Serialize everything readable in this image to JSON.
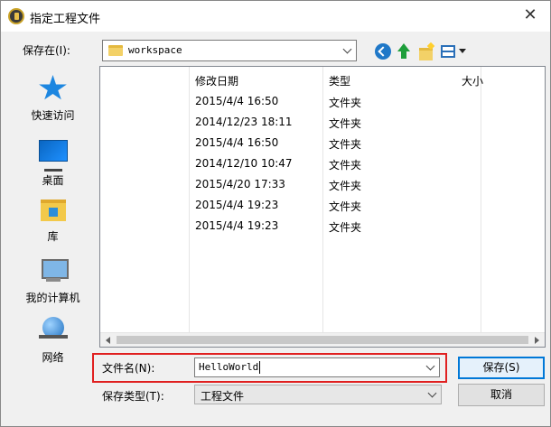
{
  "window": {
    "title": "指定工程文件",
    "close_glyph": "✕"
  },
  "location": {
    "label": "保存在(I):",
    "value": "workspace"
  },
  "toolbar": {
    "back": "back-icon",
    "up": "up-folder-icon",
    "new_folder": "new-folder-icon",
    "view_menu": "view-menu-icon"
  },
  "places": [
    {
      "label": "快速访问",
      "icon": "star-icon"
    },
    {
      "label": "桌面",
      "icon": "desktop-icon"
    },
    {
      "label": "库",
      "icon": "library-icon"
    },
    {
      "label": "我的计算机",
      "icon": "computer-icon"
    },
    {
      "label": "网络",
      "icon": "network-icon"
    }
  ],
  "columns": {
    "modified": "修改日期",
    "type": "类型",
    "size": "大小"
  },
  "rows": [
    {
      "modified": "2015/4/4 16:50",
      "type": "文件夹"
    },
    {
      "modified": "2014/12/23 18:11",
      "type": "文件夹"
    },
    {
      "modified": "2015/4/4 16:50",
      "type": "文件夹"
    },
    {
      "modified": "2014/12/10 10:47",
      "type": "文件夹"
    },
    {
      "modified": "2015/4/20 17:33",
      "type": "文件夹"
    },
    {
      "modified": "2015/4/4 19:23",
      "type": "文件夹"
    },
    {
      "modified": "2015/4/4 19:23",
      "type": "文件夹"
    }
  ],
  "filename": {
    "label": "文件名(N):",
    "value": "HelloWorld"
  },
  "filetype": {
    "label": "保存类型(T):",
    "value": "工程文件"
  },
  "buttons": {
    "save": "保存(S)",
    "cancel": "取消"
  },
  "colors": {
    "highlight_box": "#e02020",
    "primary_border": "#0078d7"
  }
}
